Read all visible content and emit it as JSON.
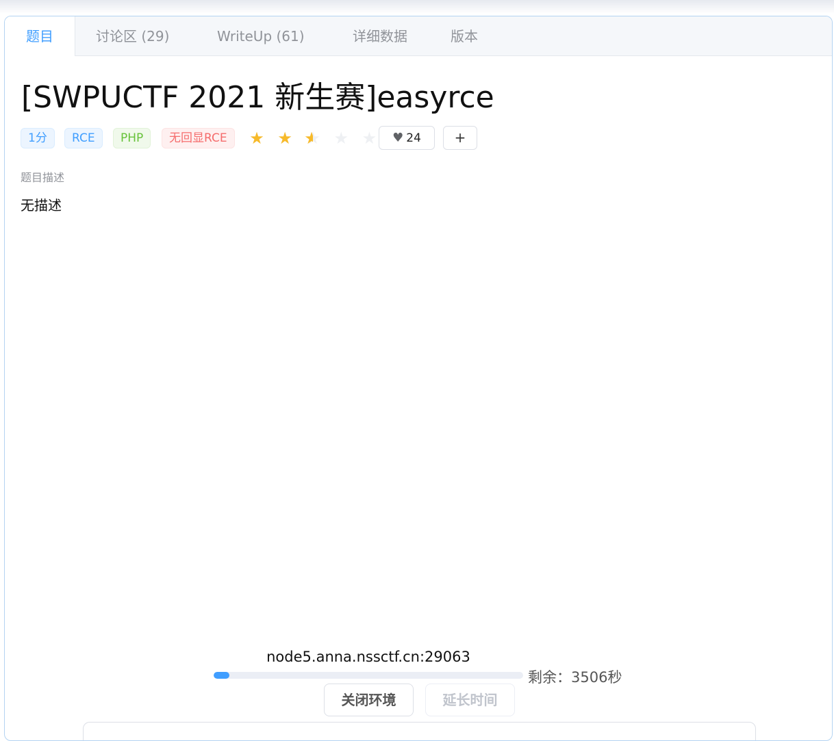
{
  "tabs": [
    {
      "label": "题目",
      "active": true
    },
    {
      "label": "讨论区 (29)",
      "active": false
    },
    {
      "label": "WriteUp (61)",
      "active": false
    },
    {
      "label": "详细数据",
      "active": false
    },
    {
      "label": "版本",
      "active": false
    }
  ],
  "problem": {
    "title": "[SWPUCTF 2021 新生赛]easyrce",
    "tags": [
      {
        "label": "1分",
        "color": "#409eff"
      },
      {
        "label": "RCE",
        "color": "#409eff"
      },
      {
        "label": "PHP",
        "color": "#67c23a"
      },
      {
        "label": "无回显RCE",
        "color": "#f56c6c"
      }
    ],
    "rating": {
      "value": 2.5,
      "max": 5,
      "star_color": "#f7ba2a"
    },
    "like_count": "24",
    "add_label": "+",
    "description_label": "题目描述",
    "description": "无描述"
  },
  "environment": {
    "host": "node5.anna.nssctf.cn:29063",
    "remaining_label": "剩余：3506秒",
    "remaining_progress": 0.05,
    "close_button": "关闭环境",
    "extend_button": "延长时间",
    "extend_disabled": true
  },
  "colors": {
    "accent": "#409eff",
    "border": "#dcdfe6"
  }
}
